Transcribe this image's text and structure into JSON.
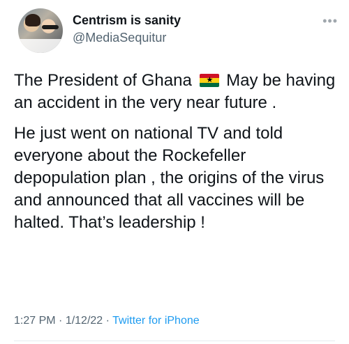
{
  "author": {
    "display_name": "Centrism is sanity",
    "handle": "@MediaSequitur"
  },
  "menu": {
    "more_label": "•••"
  },
  "tweet": {
    "p1_before_flag": "The President of Ghana",
    "flag_icon": "ghana-flag-icon",
    "p1_after_flag": "May be having an accident in the very near future .",
    "p2": "He just went on national TV and told everyone about the Rockefeller depopulation plan , the origins of the virus and announced that all vaccines will be halted. That’s leadership !"
  },
  "meta": {
    "time": "1:27 PM",
    "sep1": " · ",
    "date": "1/12/22",
    "sep2": " · ",
    "source": "Twitter for iPhone"
  },
  "colors": {
    "text": "#0f1419",
    "secondary": "#536471",
    "link": "#1d9bf0"
  }
}
